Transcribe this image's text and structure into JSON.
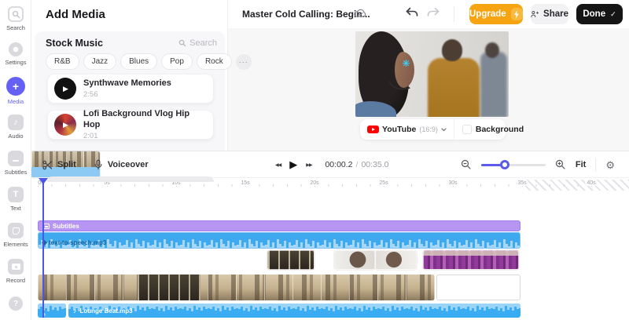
{
  "sidebar": {
    "items": [
      {
        "label": "Search"
      },
      {
        "label": "Settings"
      },
      {
        "label": "Media"
      },
      {
        "label": "Audio"
      },
      {
        "label": "Subtitles"
      },
      {
        "label": "Text"
      },
      {
        "label": "Elements"
      },
      {
        "label": "Record"
      }
    ],
    "active_item": "Media"
  },
  "media_panel": {
    "title": "Add Media",
    "section_title": "Stock Music",
    "search_label": "Search",
    "genres": [
      "R&B",
      "Jazz",
      "Blues",
      "Pop",
      "Rock"
    ],
    "more_label": "···",
    "tracks": [
      {
        "title": "Synthwave Memories",
        "duration": "2:56"
      },
      {
        "title": "Lofi Background Vlog Hip Hop",
        "duration": "2:01"
      }
    ]
  },
  "topbar": {
    "project_title": "Master Cold Calling: Begin...",
    "upgrade_label": "Upgrade",
    "share_label": "Share",
    "done_label": "Done"
  },
  "preview": {
    "platform_label": "YouTube",
    "aspect_ratio": "(16:9)",
    "background_label": "Background"
  },
  "timeline": {
    "split_label": "Split",
    "voiceover_label": "Voiceover",
    "current_time": "00:00.2",
    "time_separator": "/",
    "total_time": "00:35.0",
    "fit_label": "Fit",
    "ruler_labels": [
      "0s",
      "5s",
      "10s",
      "15s",
      "20s",
      "25s",
      "30s",
      "35s",
      "40s"
    ],
    "tracks": {
      "subtitles_label": "Subtitles",
      "tts_label": "text-to-speech.mp3",
      "music_label": "Lounge Beat.mp3"
    }
  },
  "glyphs": {
    "note": "♪",
    "plus": "+",
    "tee": "T",
    "question": "?",
    "gear": "⚙",
    "check": "✓",
    "play": "▶",
    "rewind": "◀◀",
    "forward": "▶▶"
  },
  "colors": {
    "accent": "#6561f5",
    "upgrade": "#f7a412",
    "done": "#151515",
    "playhead": "#4c55e6",
    "subtitles_track": "#b795f3",
    "tts_wave": "#3fa9f0",
    "music_track": "#3aacf2"
  }
}
